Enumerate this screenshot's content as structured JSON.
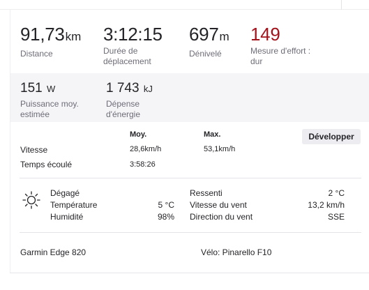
{
  "primary": [
    {
      "value": "91,73",
      "unit": "km",
      "label": "Distance"
    },
    {
      "value": "3:12:15",
      "unit": "",
      "label_line1": "Durée de",
      "label_line2": "déplacement"
    },
    {
      "value": "697",
      "unit": "m",
      "label": "Dénivelé"
    },
    {
      "value": "149",
      "unit": "",
      "label_line1": "Mesure d'effort :",
      "label_line2": "dur",
      "color": "#a3131c"
    }
  ],
  "secondary": [
    {
      "value": "151",
      "unit": "W",
      "label_line1": "Puissance moy.",
      "label_line2": "estimée"
    },
    {
      "value": "1 743",
      "unit": "kJ",
      "label_line1": "Dépense",
      "label_line2": "d'énergie"
    }
  ],
  "details": {
    "col_avg": "Moy.",
    "col_max": "Max.",
    "expand_label": "Développer",
    "rows": [
      {
        "label": "Vitesse",
        "avg": "28,6km/h",
        "max": "53,1km/h"
      },
      {
        "label": "Temps écoulé",
        "avg": "3:58:26",
        "max": ""
      }
    ]
  },
  "weather": {
    "icon": "sun-icon",
    "left": [
      {
        "label": "Dégagé",
        "value": ""
      },
      {
        "label": "Température",
        "value": "5 °C"
      },
      {
        "label": "Humidité",
        "value": "98%"
      }
    ],
    "right": [
      {
        "label": "Ressenti",
        "value": "2 °C"
      },
      {
        "label": "Vitesse du vent",
        "value": "13,2 km/h"
      },
      {
        "label": "Direction du vent",
        "value": "SSE"
      }
    ]
  },
  "device": {
    "device_name": "Garmin Edge 820",
    "bike": "Vélo: Pinarello F10"
  }
}
